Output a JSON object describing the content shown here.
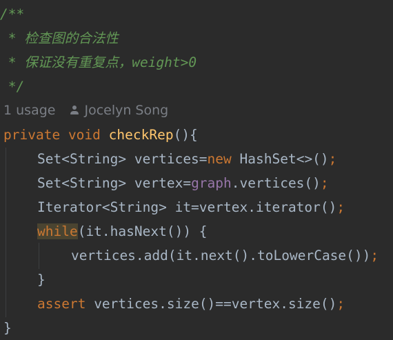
{
  "doc_comment": {
    "open": "/**",
    "line1": " * 检查图的合法性",
    "line2": " * 保证没有重复点，weight>0",
    "close": " */"
  },
  "inlay_hint": {
    "usages": "1 usage",
    "author": "Jocelyn Song",
    "icon": "user-icon"
  },
  "code": {
    "sig_kw1": "private",
    "sig_kw2": "void",
    "sig_name": "checkRep",
    "sig_rest": "(){",
    "l1_a": "Set<String> vertices=",
    "l1_new": "new",
    "l1_b": " HashSet<>()",
    "l2_a": "Set<String> vertex=",
    "l2_field": "graph",
    "l2_b": ".vertices()",
    "l3_a": "Iterator<String> it=vertex.iterator()",
    "l4_kw": "while",
    "l4_b": "(it.hasNext()) {",
    "l5": "vertices.add(it.next().toLowerCase())",
    "l6": "}",
    "l7_kw": "assert",
    "l7_b": " vertices.size()==vertex.size()",
    "l8": "}",
    "semi": ";"
  },
  "colors": {
    "background": "#2b2b2b",
    "keyword": "#cc7832",
    "method_decl": "#ffc66d",
    "field": "#9876aa",
    "doc_comment": "#629755",
    "default_text": "#a9b7c6"
  }
}
